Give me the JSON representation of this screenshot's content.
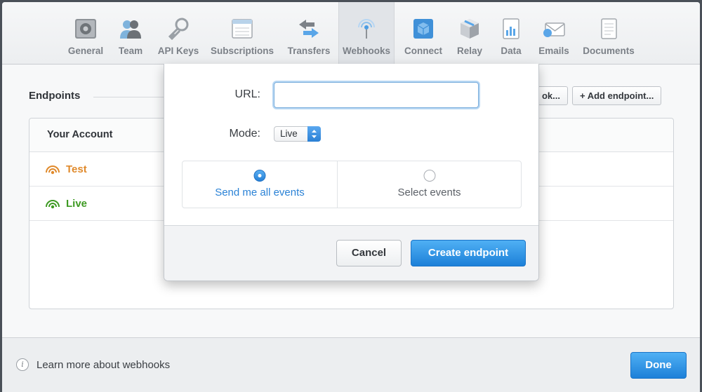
{
  "toolbar": {
    "items": [
      {
        "label": "General",
        "icon": "gear-icon"
      },
      {
        "label": "Team",
        "icon": "people-icon"
      },
      {
        "label": "API Keys",
        "icon": "key-icon"
      },
      {
        "label": "Subscriptions",
        "icon": "window-icon"
      },
      {
        "label": "Transfers",
        "icon": "transfer-arrows-icon"
      },
      {
        "label": "Webhooks",
        "icon": "antenna-icon",
        "active": true
      },
      {
        "label": "Connect",
        "icon": "cube-icon"
      },
      {
        "label": "Relay",
        "icon": "box-icon"
      },
      {
        "label": "Data",
        "icon": "chart-doc-icon"
      },
      {
        "label": "Emails",
        "icon": "envelope-icon"
      },
      {
        "label": "Documents",
        "icon": "document-icon"
      }
    ]
  },
  "main": {
    "section_title": "Endpoints",
    "test_webhook_label": "ok...",
    "add_endpoint_label": "+ Add endpoint...",
    "panel_header": "Your Account",
    "rows": [
      {
        "label": "Test",
        "color": "#e08a2c"
      },
      {
        "label": "Live",
        "color": "#3e9a23"
      }
    ]
  },
  "popover": {
    "url_label": "URL:",
    "url_value": "",
    "mode_label": "Mode:",
    "mode_value": "Live",
    "events_all_label": "Send me all events",
    "events_select_label": "Select events",
    "selected": "all",
    "cancel_label": "Cancel",
    "create_label": "Create endpoint"
  },
  "footer": {
    "learn_more": "Learn more about webhooks",
    "done_label": "Done"
  },
  "colors": {
    "accent": "#2a82d6",
    "test": "#e08a2c",
    "live": "#3e9a23"
  }
}
